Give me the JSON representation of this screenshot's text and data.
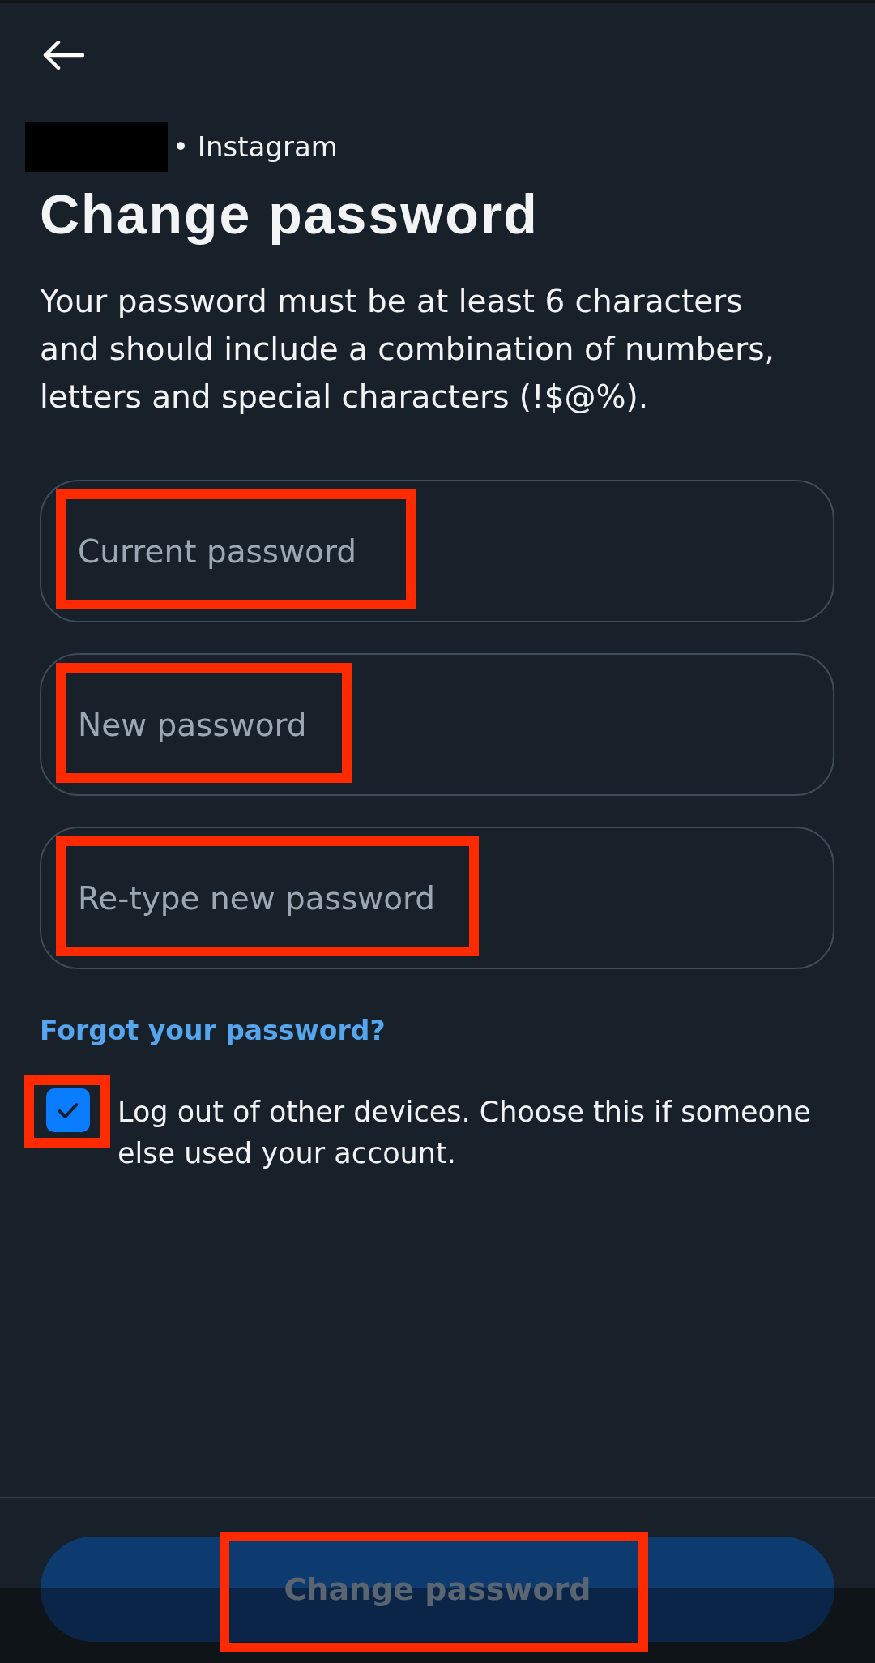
{
  "account": {
    "name_redacted": true,
    "app": "• Instagram"
  },
  "title": "Change password",
  "description": "Your password must be at least 6 characters and should include a combination of numbers, letters and special characters (!$@%).",
  "fields": [
    {
      "placeholder": "Current password",
      "highlighted": true
    },
    {
      "placeholder": "New password",
      "highlighted": true
    },
    {
      "placeholder": "Re-type new password",
      "highlighted": true
    }
  ],
  "forgot_link": "Forgot your password?",
  "logout_option": {
    "label": "Log out of other devices. Choose this if someone else used your account.",
    "checked": true,
    "highlighted": true
  },
  "submit_button": {
    "label": "Change password",
    "disabled": true,
    "highlighted": true
  }
}
